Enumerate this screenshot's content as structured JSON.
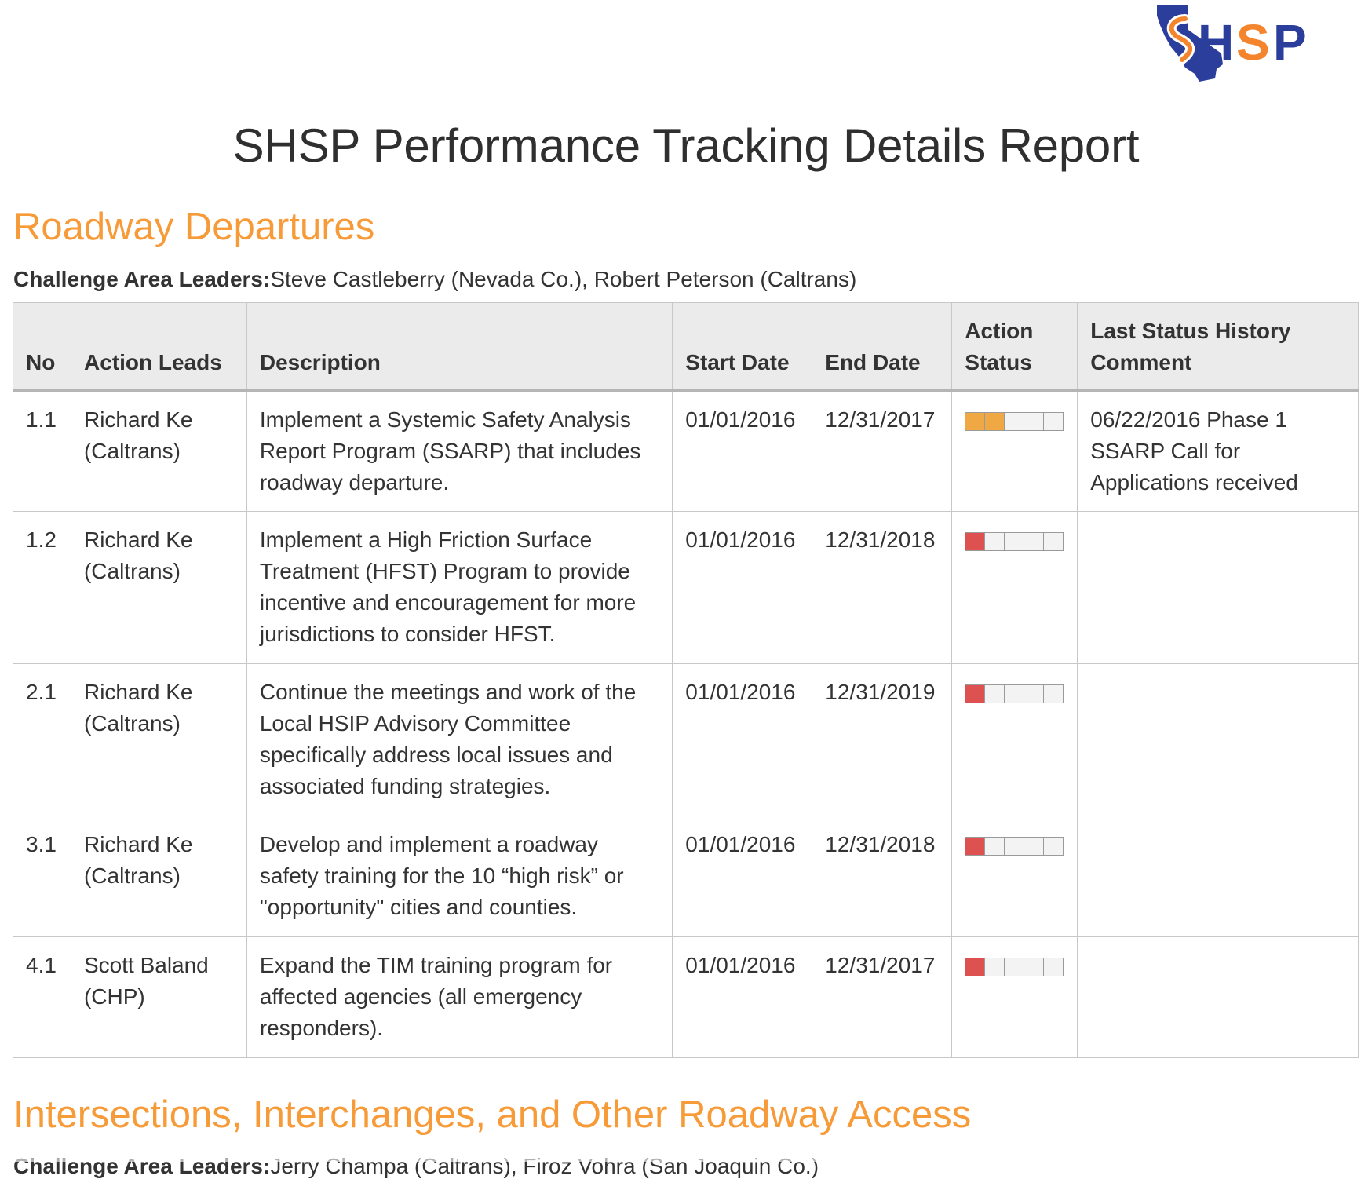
{
  "header": {
    "logo_text": "SHSP",
    "title": "SHSP Performance Tracking Details Report"
  },
  "colors": {
    "section_heading": "#f79a38",
    "status_partial": "#f0a844",
    "status_low": "#de5151",
    "status_empty": "#f3f3f3"
  },
  "sections": [
    {
      "title": "Roadway Departures",
      "leaders_label": "Challenge Area Leaders:",
      "leaders": "Steve Castleberry (Nevada Co.), Robert Peterson (Caltrans)"
    },
    {
      "title": "Intersections, Interchanges, and Other Roadway Access",
      "leaders_label": "Challenge Area Leaders:",
      "leaders": "Jerry Champa (Caltrans), Firoz Vohra (San Joaquin Co.)"
    }
  ],
  "table": {
    "headers": {
      "no": "No",
      "action_leads": "Action Leads",
      "description": "Description",
      "start_date": "Start Date",
      "end_date": "End Date",
      "action_status": "Action Status",
      "last_comment": "Last Status History Comment"
    },
    "status_segments_total": 5,
    "rows": [
      {
        "no": "1.1",
        "lead": "Richard Ke (Caltrans)",
        "description": "Implement a Systemic Safety Analysis Report Program (SSARP) that includes roadway departure.",
        "start": "01/01/2016",
        "end": "12/31/2017",
        "status_filled": 2,
        "status_color": "#f0a844",
        "comment": "06/22/2016 Phase 1 SSARP Call for Applications received"
      },
      {
        "no": "1.2",
        "lead": "Richard Ke (Caltrans)",
        "description": "Implement a High Friction Surface Treatment (HFST) Program to provide incentive and encouragement for more jurisdictions to consider HFST.",
        "start": "01/01/2016",
        "end": "12/31/2018",
        "status_filled": 1,
        "status_color": "#de5151",
        "comment": ""
      },
      {
        "no": "2.1",
        "lead": "Richard Ke (Caltrans)",
        "description": "Continue the meetings and work of the Local HSIP Advisory Committee specifically address local issues and associated funding strategies.",
        "start": "01/01/2016",
        "end": "12/31/2019",
        "status_filled": 1,
        "status_color": "#de5151",
        "comment": ""
      },
      {
        "no": "3.1",
        "lead": "Richard Ke (Caltrans)",
        "description": "Develop and implement a roadway safety training for the 10 “high risk” or \"opportunity\" cities and counties.",
        "start": "01/01/2016",
        "end": "12/31/2018",
        "status_filled": 1,
        "status_color": "#de5151",
        "comment": ""
      },
      {
        "no": "4.1",
        "lead": "Scott Baland (CHP)",
        "description": "Expand the TIM training program for affected agencies (all emergency responders).",
        "start": "01/01/2016",
        "end": "12/31/2017",
        "status_filled": 1,
        "status_color": "#de5151",
        "comment": ""
      }
    ]
  }
}
